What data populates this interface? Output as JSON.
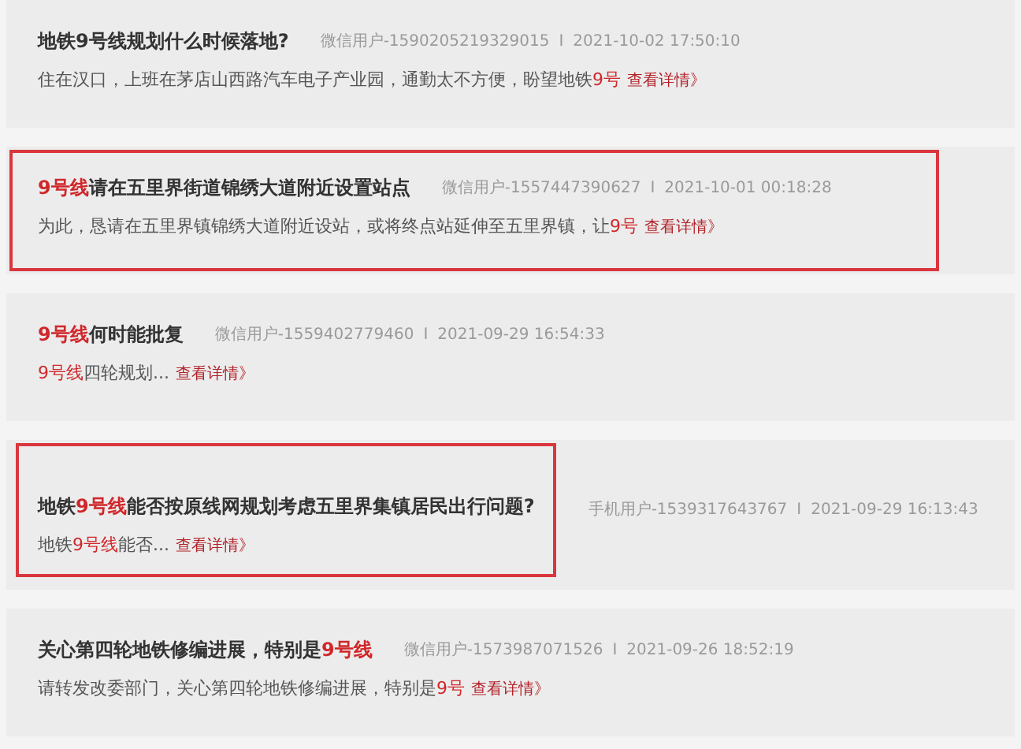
{
  "posts": [
    {
      "kind": "row",
      "framed": false,
      "title": [
        {
          "text": "地铁9号线规划什么时候落地?",
          "red": false
        }
      ],
      "user": "微信用户-1590205219329015",
      "separator": "I",
      "time": "2021-10-02 17:50:10",
      "body": [
        {
          "text": "住在汉口，上班在茅店山西路汽车电子产业园，通勤太不方便，盼望地铁",
          "red": false
        },
        {
          "text": "9号",
          "red": true
        }
      ],
      "link": "查看详情》"
    },
    {
      "kind": "row",
      "framed": true,
      "title": [
        {
          "text": "9号线",
          "red": true
        },
        {
          "text": "请在五里界街道锦绣大道附近设置站点",
          "red": false
        }
      ],
      "user": "微信用户-1557447390627",
      "separator": "I",
      "time": "2021-10-01 00:18:28",
      "body": [
        {
          "text": "为此，恳请在五里界镇锦绣大道附近设站，或将终点站延伸至五里界镇，让",
          "red": false
        },
        {
          "text": "9号",
          "red": true
        }
      ],
      "link": "查看详情》"
    },
    {
      "kind": "row",
      "framed": false,
      "title": [
        {
          "text": "9号线",
          "red": true
        },
        {
          "text": "何时能批复",
          "red": false
        }
      ],
      "user": "微信用户-1559402779460",
      "separator": "I",
      "time": "2021-09-29 16:54:33",
      "body": [
        {
          "text": "9号线",
          "red": true
        },
        {
          "text": "四轮规划...",
          "red": false
        }
      ],
      "link": "查看详情》"
    },
    {
      "kind": "split",
      "framed": true,
      "title": [
        {
          "text": "地铁",
          "red": false
        },
        {
          "text": "9号线",
          "red": true
        },
        {
          "text": "能否按原线网规划考虑五里界集镇居民出行问题?",
          "red": false
        }
      ],
      "user": "手机用户-1539317643767",
      "separator": "I",
      "time": "2021-09-29 16:13:43",
      "body": [
        {
          "text": "地铁",
          "red": false
        },
        {
          "text": "9号线",
          "red": true
        },
        {
          "text": "能否...",
          "red": false
        }
      ],
      "link": "查看详情》"
    },
    {
      "kind": "row",
      "framed": false,
      "title": [
        {
          "text": "关心第四轮地铁修编进展，特别是",
          "red": false
        },
        {
          "text": "9号线",
          "red": true
        }
      ],
      "user": "微信用户-1573987071526",
      "separator": "I",
      "time": "2021-09-26 18:52:19",
      "body": [
        {
          "text": "请转发改委部门，关心第四轮地铁修编进展，特别是",
          "red": false
        },
        {
          "text": "9号",
          "red": true
        }
      ],
      "link": "查看详情》"
    }
  ]
}
